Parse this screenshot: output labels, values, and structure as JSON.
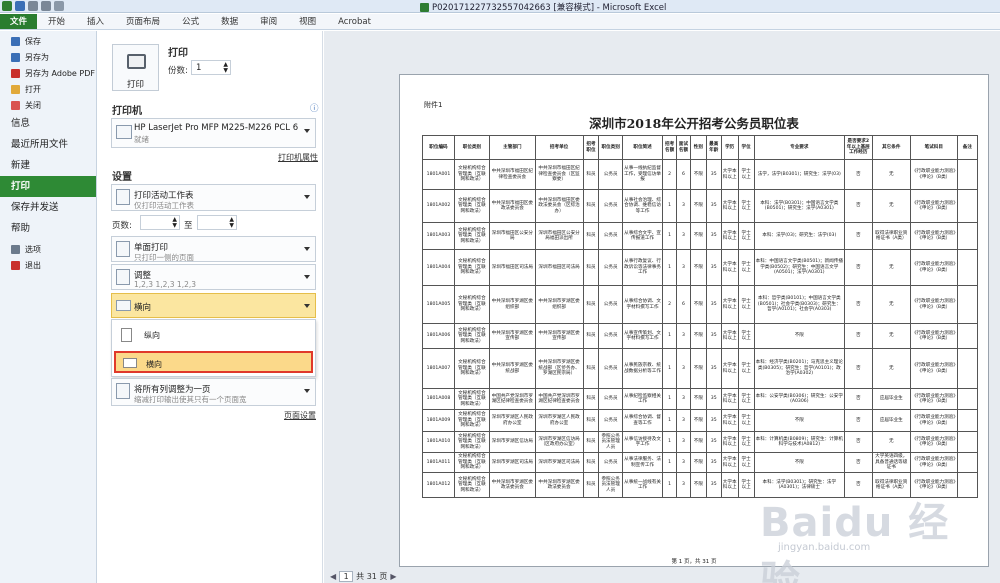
{
  "window": {
    "title": "P020171227732557042663 [兼容模式] - Microsoft Excel"
  },
  "tabs": [
    "文件",
    "开始",
    "插入",
    "页面布局",
    "公式",
    "数据",
    "审阅",
    "视图",
    "Acrobat"
  ],
  "nav": {
    "small_top": [
      {
        "label": "保存",
        "icon": "save-icon",
        "color": "#3b6fb6"
      },
      {
        "label": "另存为",
        "icon": "save-as-icon",
        "color": "#3b6fb6"
      },
      {
        "label": "另存为 Adobe PDF",
        "icon": "pdf-icon",
        "color": "#c9302c"
      },
      {
        "label": "打开",
        "icon": "open-folder-icon",
        "color": "#e1a93a"
      },
      {
        "label": "关闭",
        "icon": "close-file-icon",
        "color": "#d9534f"
      }
    ],
    "big": [
      {
        "label": "信息",
        "active": false
      },
      {
        "label": "最近所用文件",
        "active": false
      },
      {
        "label": "新建",
        "active": false
      },
      {
        "label": "打印",
        "active": true
      },
      {
        "label": "保存并发送",
        "active": false
      },
      {
        "label": "帮助",
        "active": false
      }
    ],
    "small_bottom": [
      {
        "label": "选项",
        "icon": "options-icon",
        "color": "#6b7a8c"
      },
      {
        "label": "退出",
        "icon": "exit-icon",
        "color": "#c9302c"
      }
    ]
  },
  "print": {
    "heading": "打印",
    "button": "打印",
    "copies_label": "份数:",
    "copies_value": "1"
  },
  "printer": {
    "heading": "打印机",
    "name": "HP LaserJet Pro MFP M225-M226 PCL 6",
    "status": "就绪",
    "properties_link": "打印机属性"
  },
  "settings": {
    "heading": "设置",
    "active_sheets": {
      "title": "打印活动工作表",
      "sub": "仅打印活动工作表"
    },
    "pages_label": "页数:",
    "to_label": "至",
    "sides": {
      "title": "单面打印",
      "sub": "只打印一侧的页面"
    },
    "collate": {
      "title": "调整",
      "sub": "1,2,3    1,2,3    1,2,3"
    },
    "orientation": {
      "title": "横向"
    },
    "orientation_options": [
      {
        "label": "纵向",
        "selected": false
      },
      {
        "label": "横向",
        "selected": true
      }
    ],
    "scaling": {
      "title": "将所有列调整为一页",
      "sub": "缩减打印输出使其只有一个页面宽"
    },
    "page_setup_link": "页面设置"
  },
  "preview": {
    "attachment_label": "附件1",
    "title": "深圳市2018年公开招考公务员职位表",
    "footer": "第 1 页，共 31 页",
    "headers": [
      "职位编码",
      "职位类别",
      "主管部门",
      "招考单位",
      "招考职位",
      "职位类别",
      "职位简述",
      "招考名额",
      "面试名额",
      "性别",
      "最高年龄",
      "学历",
      "学位",
      "专业要求",
      "是否要求2年以上基层工作经历",
      "其它条件",
      "笔试科目",
      "备注"
    ],
    "rows": [
      [
        "1801A001",
        "文秘机构综合管理类（互联网和政法）",
        "中共深圳市福田区纪律检查委员会",
        "中共深圳市福田区纪律检查委员会（区监察委）",
        "科员",
        "公务员",
        "从事一线执纪监督工作，受理信访举报",
        "2",
        "6",
        "不限",
        "35",
        "大学本科以上",
        "学士以上",
        "法学，法学(B0301)；研究生：法学(03)",
        "否",
        "无",
        "《行政职业能力测验》《申论》（B类）",
        ""
      ],
      [
        "1801A002",
        "文秘机构综合管理类（互联网和政法）",
        "中共深圳市福田区委政法委员会",
        "中共深圳市福田区委政法委员会（区综治办）",
        "科员",
        "公务员",
        "从事社会治理、综合协调、维稳信访等工作",
        "1",
        "3",
        "不限",
        "35",
        "大学本科以上",
        "学士以上",
        "本科：法学(B0301)；中国语言文学类(B0501)；研究生：法学(A0301)",
        "否",
        "无",
        "《行政职业能力测验》《申论》（B类）",
        ""
      ],
      [
        "1801A003",
        "文秘机构综合管理类（互联网和政法）",
        "深圳市福田区公安分局",
        "深圳市福田区公安分局福田派出所",
        "科员",
        "公务员",
        "从事综合文字、宣传报道工作",
        "1",
        "3",
        "不限",
        "35",
        "大学本科以上",
        "学士以上",
        "本科：法学(03)；研究生：法学(03)",
        "否",
        "取得法律职业资格证书（A类）",
        "《行政职业能力测验》《申论》（B类）",
        ""
      ],
      [
        "1801A004",
        "文秘机构综合管理类（互联网和政法）",
        "深圳市福田区司法局",
        "深圳市福田区司法局",
        "科员",
        "公务员",
        "从事行政复议、行政诉讼等法律事务工作",
        "1",
        "3",
        "不限",
        "35",
        "大学本科以上",
        "学士以上",
        "本科：中国语言文学类(B0501)；新闻传播学类(B0502)；研究生：中国语言文学(A0501)；法学(A0301)",
        "否",
        "无",
        "《行政职业能力测验》《申论》（B类）",
        ""
      ],
      [
        "1801A005",
        "文秘机构综合管理类（互联网和政法）",
        "中共深圳市罗湖区委组织部",
        "中共深圳市罗湖区委组织部",
        "科员",
        "公务员",
        "从事综合协调、文字材料撰写工作",
        "2",
        "6",
        "不限",
        "35",
        "大学本科以上",
        "学士以上",
        "本科：哲学类(B0101)；中国语言文学类(B0501)；社会学类(B0303)；研究生：哲学(A0101)；社会学(A0303)",
        "否",
        "无",
        "《行政职业能力测验》《申论》（B类）",
        ""
      ],
      [
        "1801A006",
        "文秘机构综合管理类（互联网和政法）",
        "中共深圳市罗湖区委宣传部",
        "中共深圳市罗湖区委宣传部",
        "科员",
        "公务员",
        "从事宣传策划、文字材料撰写工作",
        "1",
        "3",
        "不限",
        "35",
        "大学本科以上",
        "学士以上",
        "不限",
        "否",
        "无",
        "《行政职业能力测验》《申论》（B类）",
        ""
      ],
      [
        "1801A007",
        "文秘机构综合管理类（互联网和政法）",
        "中共深圳市罗湖区委统战部",
        "中共深圳市罗湖区委统战部（区侨务办、罗湖区民宗局）",
        "科员",
        "公务员",
        "从事民族宗教、统战数据分析等工作",
        "1",
        "3",
        "不限",
        "35",
        "大学本科以上",
        "学士以上",
        "本科：经济学类(B0201)；马克思主义理论类(B0305)；研究生：哲学(A0101)；政治学(A0302)",
        "否",
        "无",
        "《行政职业能力测验》《申论》（B类）",
        ""
      ],
      [
        "1801A008",
        "文秘机构综合管理类（互联网和政法）",
        "中国共产党深圳市罗湖区纪律检查委员会",
        "中国共产党深圳市罗湖区纪律检查委员会",
        "科员",
        "公务员",
        "从事纪检监察相关工作",
        "1",
        "3",
        "不限",
        "35",
        "大学本科以上",
        "学士以上",
        "本科：公安学类(B0306)；研究生：公安学(A0306)",
        "否",
        "应届毕业生",
        "《行政职业能力测验》《申论》（B类）",
        ""
      ],
      [
        "1801A009",
        "文秘机构综合管理类（互联网和政法）",
        "深圳市罗湖区人民政府办公室",
        "深圳市罗湖区人民政府办公室",
        "科员",
        "公务员",
        "从事综合协调、督查等工作",
        "1",
        "3",
        "不限",
        "35",
        "大学本科以上",
        "学士以上",
        "不限",
        "否",
        "应届毕业生",
        "《行政职业能力测验》《申论》（B类）",
        ""
      ],
      [
        "1801A010",
        "文秘机构综合管理类（互联网和政法）",
        "深圳市罗湖区信访局",
        "深圳市罗湖区信访局（区政府办公室）",
        "科员",
        "参照公务员法管理人员",
        "从事信访接待及文字工作",
        "1",
        "3",
        "不限",
        "35",
        "大学本科以上",
        "学士以上",
        "本科：计算机类(B0809)；研究生：计算机科学与技术(A0812)",
        "否",
        "无",
        "《行政职业能力测验》《申论》（B类）",
        ""
      ],
      [
        "1801A011",
        "文秘机构综合管理类（互联网和政法）",
        "深圳市罗湖区司法局",
        "深圳市罗湖区司法局",
        "科员",
        "公务员",
        "从事法律服务、法制宣传工作",
        "1",
        "3",
        "不限",
        "35",
        "大学本科以上",
        "学士以上",
        "不限",
        "否",
        "大学英语四级，具备普通话等级证书",
        "《行政职业能力测验》《申论》（B类）",
        ""
      ],
      [
        "1801A012",
        "文秘机构综合管理类（互联网和政法）",
        "中共深圳市罗湖区委政法委员会",
        "中共深圳市罗湖区委政法委员会",
        "科员",
        "参照公务员法管理人员",
        "从事统一战线有关工作",
        "1",
        "3",
        "不限",
        "35",
        "大学本科以上",
        "学士以上",
        "本科：法学(B0301)；研究生：法学(A0301)；法律硕士",
        "否",
        "取得法律职业资格证书（A类）",
        "《行政职业能力测验》《申论》（B类）",
        ""
      ]
    ]
  },
  "pager": {
    "prev": "◀",
    "page": "1",
    "total": "共 31 页",
    "next": "▶"
  },
  "watermark": {
    "logo": "Baidu 经验",
    "url": "jingyan.baidu.com"
  }
}
